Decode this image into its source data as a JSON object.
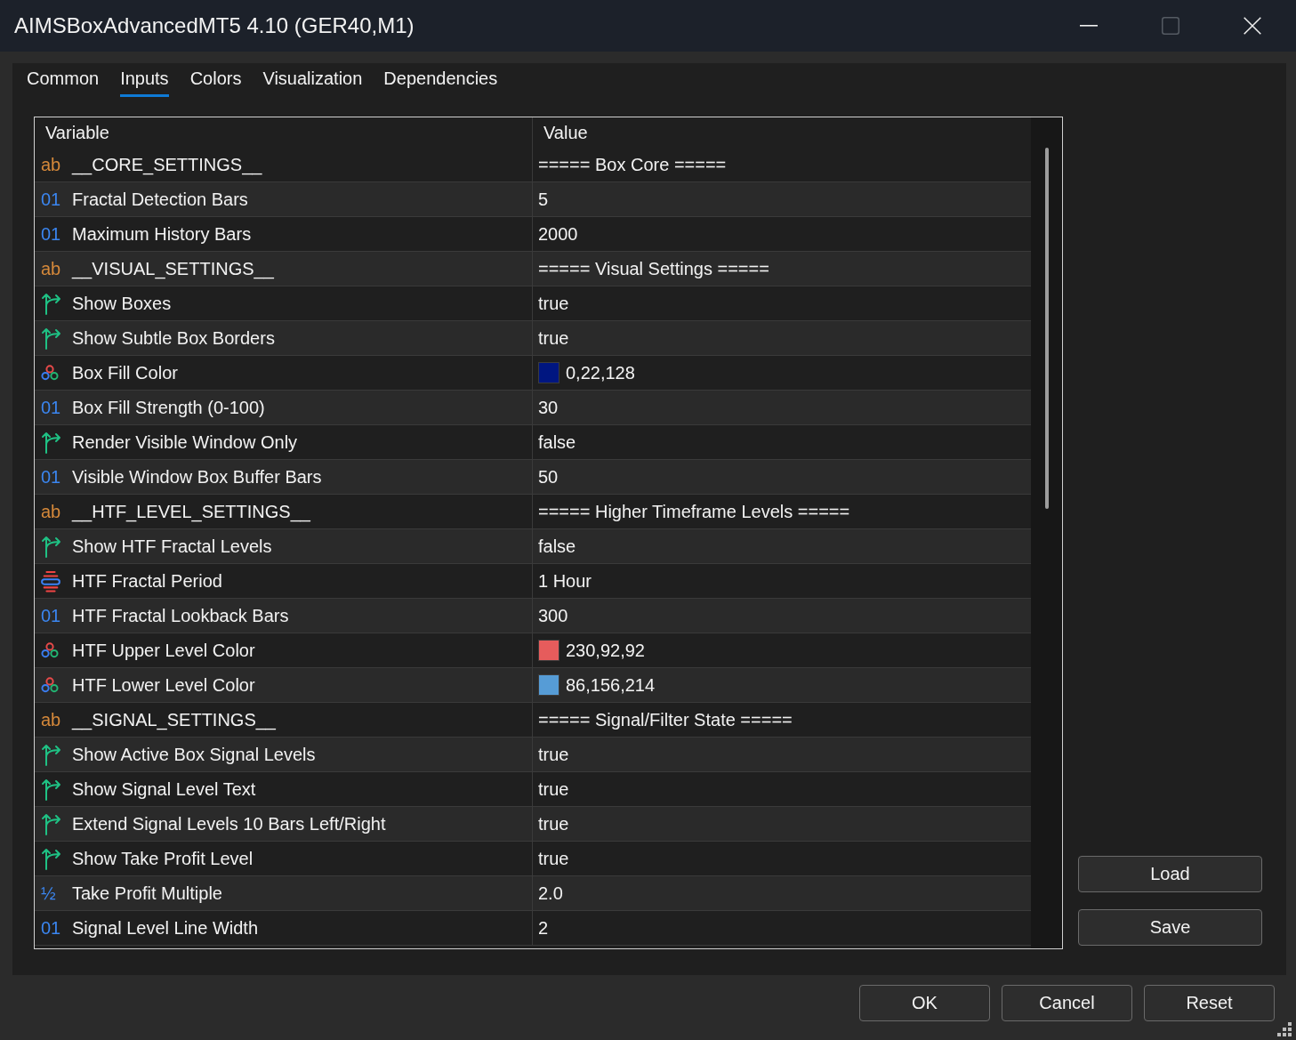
{
  "window": {
    "title": "AIMSBoxAdvancedMT5 4.10 (GER40,M1)"
  },
  "tabs": [
    {
      "label": "Common",
      "selected": false
    },
    {
      "label": "Inputs",
      "selected": true
    },
    {
      "label": "Colors",
      "selected": false
    },
    {
      "label": "Visualization",
      "selected": false
    },
    {
      "label": "Dependencies",
      "selected": false
    }
  ],
  "table": {
    "columns": [
      "Variable",
      "Value"
    ],
    "rows": [
      {
        "kind": "string",
        "icon": "ab",
        "variable": "__CORE_SETTINGS__",
        "value": "===== Box Core ====="
      },
      {
        "kind": "int",
        "icon": "01",
        "variable": "Fractal Detection Bars",
        "value": "5"
      },
      {
        "kind": "int",
        "icon": "01",
        "variable": "Maximum History Bars",
        "value": "2000"
      },
      {
        "kind": "string",
        "icon": "ab",
        "variable": "__VISUAL_SETTINGS__",
        "value": "===== Visual Settings ====="
      },
      {
        "kind": "bool",
        "variable": "Show Boxes",
        "value": "true"
      },
      {
        "kind": "bool",
        "variable": "Show Subtle Box Borders",
        "value": "true"
      },
      {
        "kind": "color",
        "variable": "Box Fill Color",
        "value": "0,22,128",
        "color": "#001680"
      },
      {
        "kind": "int",
        "icon": "01",
        "variable": "Box Fill Strength (0-100)",
        "value": "30"
      },
      {
        "kind": "bool",
        "variable": "Render Visible Window Only",
        "value": "false"
      },
      {
        "kind": "int",
        "icon": "01",
        "variable": "Visible Window Box Buffer Bars",
        "value": "50"
      },
      {
        "kind": "string",
        "icon": "ab",
        "variable": "__HTF_LEVEL_SETTINGS__",
        "value": "===== Higher Timeframe Levels ====="
      },
      {
        "kind": "bool",
        "variable": "Show HTF Fractal Levels",
        "value": "false"
      },
      {
        "kind": "enum",
        "variable": "HTF Fractal Period",
        "value": "1 Hour"
      },
      {
        "kind": "int",
        "icon": "01",
        "variable": "HTF Fractal Lookback Bars",
        "value": "300"
      },
      {
        "kind": "color",
        "variable": "HTF Upper Level Color",
        "value": "230,92,92",
        "color": "#e65c5c"
      },
      {
        "kind": "color",
        "variable": "HTF Lower Level Color",
        "value": "86,156,214",
        "color": "#569cd6"
      },
      {
        "kind": "string",
        "icon": "ab",
        "variable": "__SIGNAL_SETTINGS__",
        "value": "===== Signal/Filter State ====="
      },
      {
        "kind": "bool",
        "variable": "Show Active Box Signal Levels",
        "value": "true"
      },
      {
        "kind": "bool",
        "variable": "Show Signal Level Text",
        "value": "true"
      },
      {
        "kind": "bool",
        "variable": "Extend Signal Levels 10 Bars Left/Right",
        "value": "true"
      },
      {
        "kind": "bool",
        "variable": "Show Take Profit Level",
        "value": "true"
      },
      {
        "kind": "double",
        "icon": "½",
        "variable": "Take Profit Multiple",
        "value": "2.0"
      },
      {
        "kind": "int",
        "icon": "01",
        "variable": "Signal Level Line Width",
        "value": "2"
      }
    ]
  },
  "side_buttons": [
    "Load",
    "Save"
  ],
  "buttons": [
    "OK",
    "Cancel",
    "Reset"
  ]
}
